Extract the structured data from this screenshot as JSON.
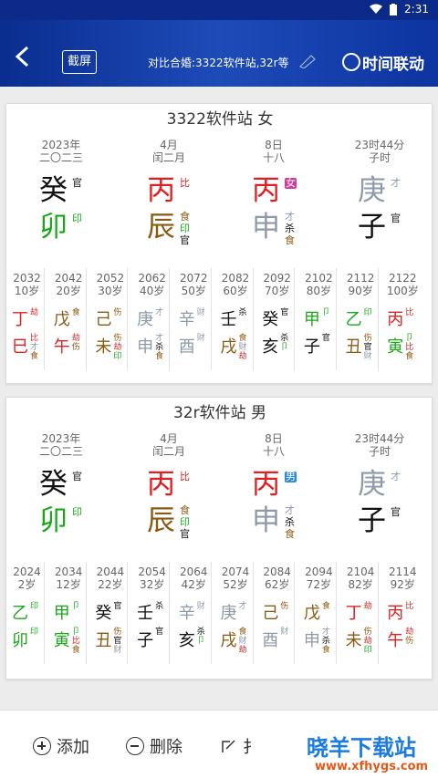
{
  "status": {
    "time": "2:31"
  },
  "header": {
    "screenshot_label": "截屏",
    "compare_text": "对比合婚:3322软件站,32r等",
    "time_link_label": "时间联动"
  },
  "cards": [
    {
      "title": "3322软件站 女",
      "pillars": [
        {
          "d1": "2023年",
          "d2": "二〇二三",
          "stem": "癸",
          "stem_color": "#111111",
          "stem_tag": "官",
          "stem_tag_color": "#111111",
          "branch": "卯",
          "branch_color": "#1aa81a",
          "branch_tags": [
            {
              "t": "印",
              "c": "#1aa81a"
            }
          ]
        },
        {
          "d1": "4月",
          "d2": "闰二月",
          "stem": "丙",
          "stem_color": "#e02020",
          "stem_tag": "比",
          "stem_tag_color": "#e02020",
          "branch": "辰",
          "branch_color": "#8a5a10",
          "branch_tags": [
            {
              "t": "食",
              "c": "#8a5a10"
            },
            {
              "t": "印",
              "c": "#1aa81a"
            },
            {
              "t": "官",
              "c": "#111111"
            }
          ]
        },
        {
          "d1": "8日",
          "d2": "十八",
          "stem": "丙",
          "stem_color": "#e02020",
          "stem_tag": "女",
          "stem_tag_color": "#d23a9a",
          "stem_tag_box": true,
          "branch": "申",
          "branch_color": "#8e9aa8",
          "branch_tags": [
            {
              "t": "才",
              "c": "#8e9aa8"
            },
            {
              "t": "杀",
              "c": "#111111"
            },
            {
              "t": "食",
              "c": "#8a5a10"
            }
          ]
        },
        {
          "d1": "23时44分",
          "d2": "子时",
          "stem": "庚",
          "stem_color": "#8e9aa8",
          "stem_tag": "才",
          "stem_tag_color": "#8e9aa8",
          "branch": "子",
          "branch_color": "#111111",
          "branch_tags": [
            {
              "t": "官",
              "c": "#111111"
            }
          ]
        }
      ],
      "dayun": [
        {
          "y": "2032",
          "a": "10岁",
          "s": "丁",
          "sc": "#e02020",
          "st": [
            "劫"
          ],
          "stc": [
            "#e02020"
          ],
          "b": "巳",
          "bc": "#e02020",
          "bt": [
            "比",
            "才",
            "食"
          ],
          "btc": [
            "#e02020",
            "#8e9aa8",
            "#8a5a10"
          ]
        },
        {
          "y": "2042",
          "a": "20岁",
          "s": "戊",
          "sc": "#8a5a10",
          "st": [
            "食"
          ],
          "stc": [
            "#8a5a10"
          ],
          "b": "午",
          "bc": "#e02020",
          "bt": [
            "劫",
            "伤"
          ],
          "btc": [
            "#e02020",
            "#8a5a10"
          ]
        },
        {
          "y": "2052",
          "a": "30岁",
          "s": "己",
          "sc": "#8a5a10",
          "st": [
            "伤"
          ],
          "stc": [
            "#8a5a10"
          ],
          "b": "未",
          "bc": "#8a5a10",
          "bt": [
            "伤",
            "劫",
            "印"
          ],
          "btc": [
            "#8a5a10",
            "#e02020",
            "#1aa81a"
          ]
        },
        {
          "y": "2062",
          "a": "40岁",
          "s": "庚",
          "sc": "#8e9aa8",
          "st": [
            "才"
          ],
          "stc": [
            "#8e9aa8"
          ],
          "b": "申",
          "bc": "#8e9aa8",
          "bt": [
            "才",
            "杀",
            "食"
          ],
          "btc": [
            "#8e9aa8",
            "#111111",
            "#8a5a10"
          ]
        },
        {
          "y": "2072",
          "a": "50岁",
          "s": "辛",
          "sc": "#8e9aa8",
          "st": [
            "财"
          ],
          "stc": [
            "#8e9aa8"
          ],
          "b": "酉",
          "bc": "#8e9aa8",
          "bt": [
            "财"
          ],
          "btc": [
            "#8e9aa8"
          ]
        },
        {
          "y": "2082",
          "a": "60岁",
          "s": "壬",
          "sc": "#111111",
          "st": [
            "杀"
          ],
          "stc": [
            "#111111"
          ],
          "b": "戌",
          "bc": "#8a5a10",
          "bt": [
            "食",
            "财",
            "劫"
          ],
          "btc": [
            "#8a5a10",
            "#8e9aa8",
            "#e02020"
          ]
        },
        {
          "y": "2092",
          "a": "70岁",
          "s": "癸",
          "sc": "#111111",
          "st": [
            "官"
          ],
          "stc": [
            "#111111"
          ],
          "b": "亥",
          "bc": "#111111",
          "bt": [
            "杀",
            "卩"
          ],
          "btc": [
            "#111111",
            "#1aa81a"
          ]
        },
        {
          "y": "2102",
          "a": "80岁",
          "s": "甲",
          "sc": "#1aa81a",
          "st": [
            "卩"
          ],
          "stc": [
            "#1aa81a"
          ],
          "b": "子",
          "bc": "#111111",
          "bt": [
            "官"
          ],
          "btc": [
            "#111111"
          ]
        },
        {
          "y": "2112",
          "a": "90岁",
          "s": "乙",
          "sc": "#1aa81a",
          "st": [
            "印"
          ],
          "stc": [
            "#1aa81a"
          ],
          "b": "丑",
          "bc": "#8a5a10",
          "bt": [
            "伤",
            "官",
            "财"
          ],
          "btc": [
            "#8a5a10",
            "#111111",
            "#8e9aa8"
          ]
        },
        {
          "y": "2122",
          "a": "100岁",
          "s": "丙",
          "sc": "#e02020",
          "st": [
            "比"
          ],
          "stc": [
            "#e02020"
          ],
          "b": "寅",
          "bc": "#1aa81a",
          "bt": [
            "卩",
            "比",
            "食"
          ],
          "btc": [
            "#1aa81a",
            "#e02020",
            "#8a5a10"
          ]
        }
      ]
    },
    {
      "title": "32r软件站 男",
      "pillars": [
        {
          "d1": "2023年",
          "d2": "二〇二三",
          "stem": "癸",
          "stem_color": "#111111",
          "stem_tag": "官",
          "stem_tag_color": "#111111",
          "branch": "卯",
          "branch_color": "#1aa81a",
          "branch_tags": [
            {
              "t": "印",
              "c": "#1aa81a"
            }
          ]
        },
        {
          "d1": "4月",
          "d2": "闰二月",
          "stem": "丙",
          "stem_color": "#e02020",
          "stem_tag": "比",
          "stem_tag_color": "#e02020",
          "branch": "辰",
          "branch_color": "#8a5a10",
          "branch_tags": [
            {
              "t": "食",
              "c": "#8a5a10"
            },
            {
              "t": "印",
              "c": "#1aa81a"
            },
            {
              "t": "官",
              "c": "#111111"
            }
          ]
        },
        {
          "d1": "8日",
          "d2": "十八",
          "stem": "丙",
          "stem_color": "#e02020",
          "stem_tag": "男",
          "stem_tag_color": "#2d8ae0",
          "stem_tag_box": true,
          "branch": "申",
          "branch_color": "#8e9aa8",
          "branch_tags": [
            {
              "t": "才",
              "c": "#8e9aa8"
            },
            {
              "t": "杀",
              "c": "#111111"
            },
            {
              "t": "食",
              "c": "#8a5a10"
            }
          ]
        },
        {
          "d1": "23时44分",
          "d2": "子时",
          "stem": "庚",
          "stem_color": "#8e9aa8",
          "stem_tag": "才",
          "stem_tag_color": "#8e9aa8",
          "branch": "子",
          "branch_color": "#111111",
          "branch_tags": [
            {
              "t": "官",
              "c": "#111111"
            }
          ]
        }
      ],
      "dayun": [
        {
          "y": "2024",
          "a": "2岁",
          "s": "乙",
          "sc": "#1aa81a",
          "st": [
            "印"
          ],
          "stc": [
            "#1aa81a"
          ],
          "b": "卯",
          "bc": "#1aa81a",
          "bt": [
            "印"
          ],
          "btc": [
            "#1aa81a"
          ]
        },
        {
          "y": "2034",
          "a": "12岁",
          "s": "甲",
          "sc": "#1aa81a",
          "st": [
            "卩"
          ],
          "stc": [
            "#1aa81a"
          ],
          "b": "寅",
          "bc": "#1aa81a",
          "bt": [
            "卩",
            "比",
            "食"
          ],
          "btc": [
            "#1aa81a",
            "#e02020",
            "#8a5a10"
          ]
        },
        {
          "y": "2044",
          "a": "22岁",
          "s": "癸",
          "sc": "#111111",
          "st": [
            "官"
          ],
          "stc": [
            "#111111"
          ],
          "b": "丑",
          "bc": "#8a5a10",
          "bt": [
            "伤",
            "官",
            "财"
          ],
          "btc": [
            "#8a5a10",
            "#111111",
            "#8e9aa8"
          ]
        },
        {
          "y": "2054",
          "a": "32岁",
          "s": "壬",
          "sc": "#111111",
          "st": [
            "杀"
          ],
          "stc": [
            "#111111"
          ],
          "b": "子",
          "bc": "#111111",
          "bt": [
            "官"
          ],
          "btc": [
            "#111111"
          ]
        },
        {
          "y": "2064",
          "a": "42岁",
          "s": "辛",
          "sc": "#8e9aa8",
          "st": [
            "财"
          ],
          "stc": [
            "#8e9aa8"
          ],
          "b": "亥",
          "bc": "#111111",
          "bt": [
            "杀",
            "卩"
          ],
          "btc": [
            "#111111",
            "#1aa81a"
          ]
        },
        {
          "y": "2074",
          "a": "52岁",
          "s": "庚",
          "sc": "#8e9aa8",
          "st": [
            "才"
          ],
          "stc": [
            "#8e9aa8"
          ],
          "b": "戌",
          "bc": "#8a5a10",
          "bt": [
            "食",
            "财",
            "劫"
          ],
          "btc": [
            "#8a5a10",
            "#8e9aa8",
            "#e02020"
          ]
        },
        {
          "y": "2084",
          "a": "62岁",
          "s": "己",
          "sc": "#8a5a10",
          "st": [
            "伤"
          ],
          "stc": [
            "#8a5a10"
          ],
          "b": "酉",
          "bc": "#8e9aa8",
          "bt": [
            "财"
          ],
          "btc": [
            "#8e9aa8"
          ]
        },
        {
          "y": "2094",
          "a": "72岁",
          "s": "戊",
          "sc": "#8a5a10",
          "st": [
            "食"
          ],
          "stc": [
            "#8a5a10"
          ],
          "b": "申",
          "bc": "#8e9aa8",
          "bt": [
            "才",
            "杀",
            "食"
          ],
          "btc": [
            "#8e9aa8",
            "#111111",
            "#8a5a10"
          ]
        },
        {
          "y": "2104",
          "a": "82岁",
          "s": "丁",
          "sc": "#e02020",
          "st": [
            "劫"
          ],
          "stc": [
            "#e02020"
          ],
          "b": "未",
          "bc": "#8a5a10",
          "bt": [
            "伤",
            "劫",
            "印"
          ],
          "btc": [
            "#8a5a10",
            "#e02020",
            "#1aa81a"
          ]
        },
        {
          "y": "2114",
          "a": "92岁",
          "s": "丙",
          "sc": "#e02020",
          "st": [
            "比"
          ],
          "stc": [
            "#e02020"
          ],
          "b": "午",
          "bc": "#e02020",
          "bt": [
            "劫",
            "伤"
          ],
          "btc": [
            "#e02020",
            "#8a5a10"
          ]
        }
      ]
    }
  ],
  "bottom": {
    "add_label": "添加",
    "delete_label": "删除",
    "edit_label": "扌",
    "watermark": "晓羊下载站",
    "watermark_url": "www.xfhygs.com"
  }
}
